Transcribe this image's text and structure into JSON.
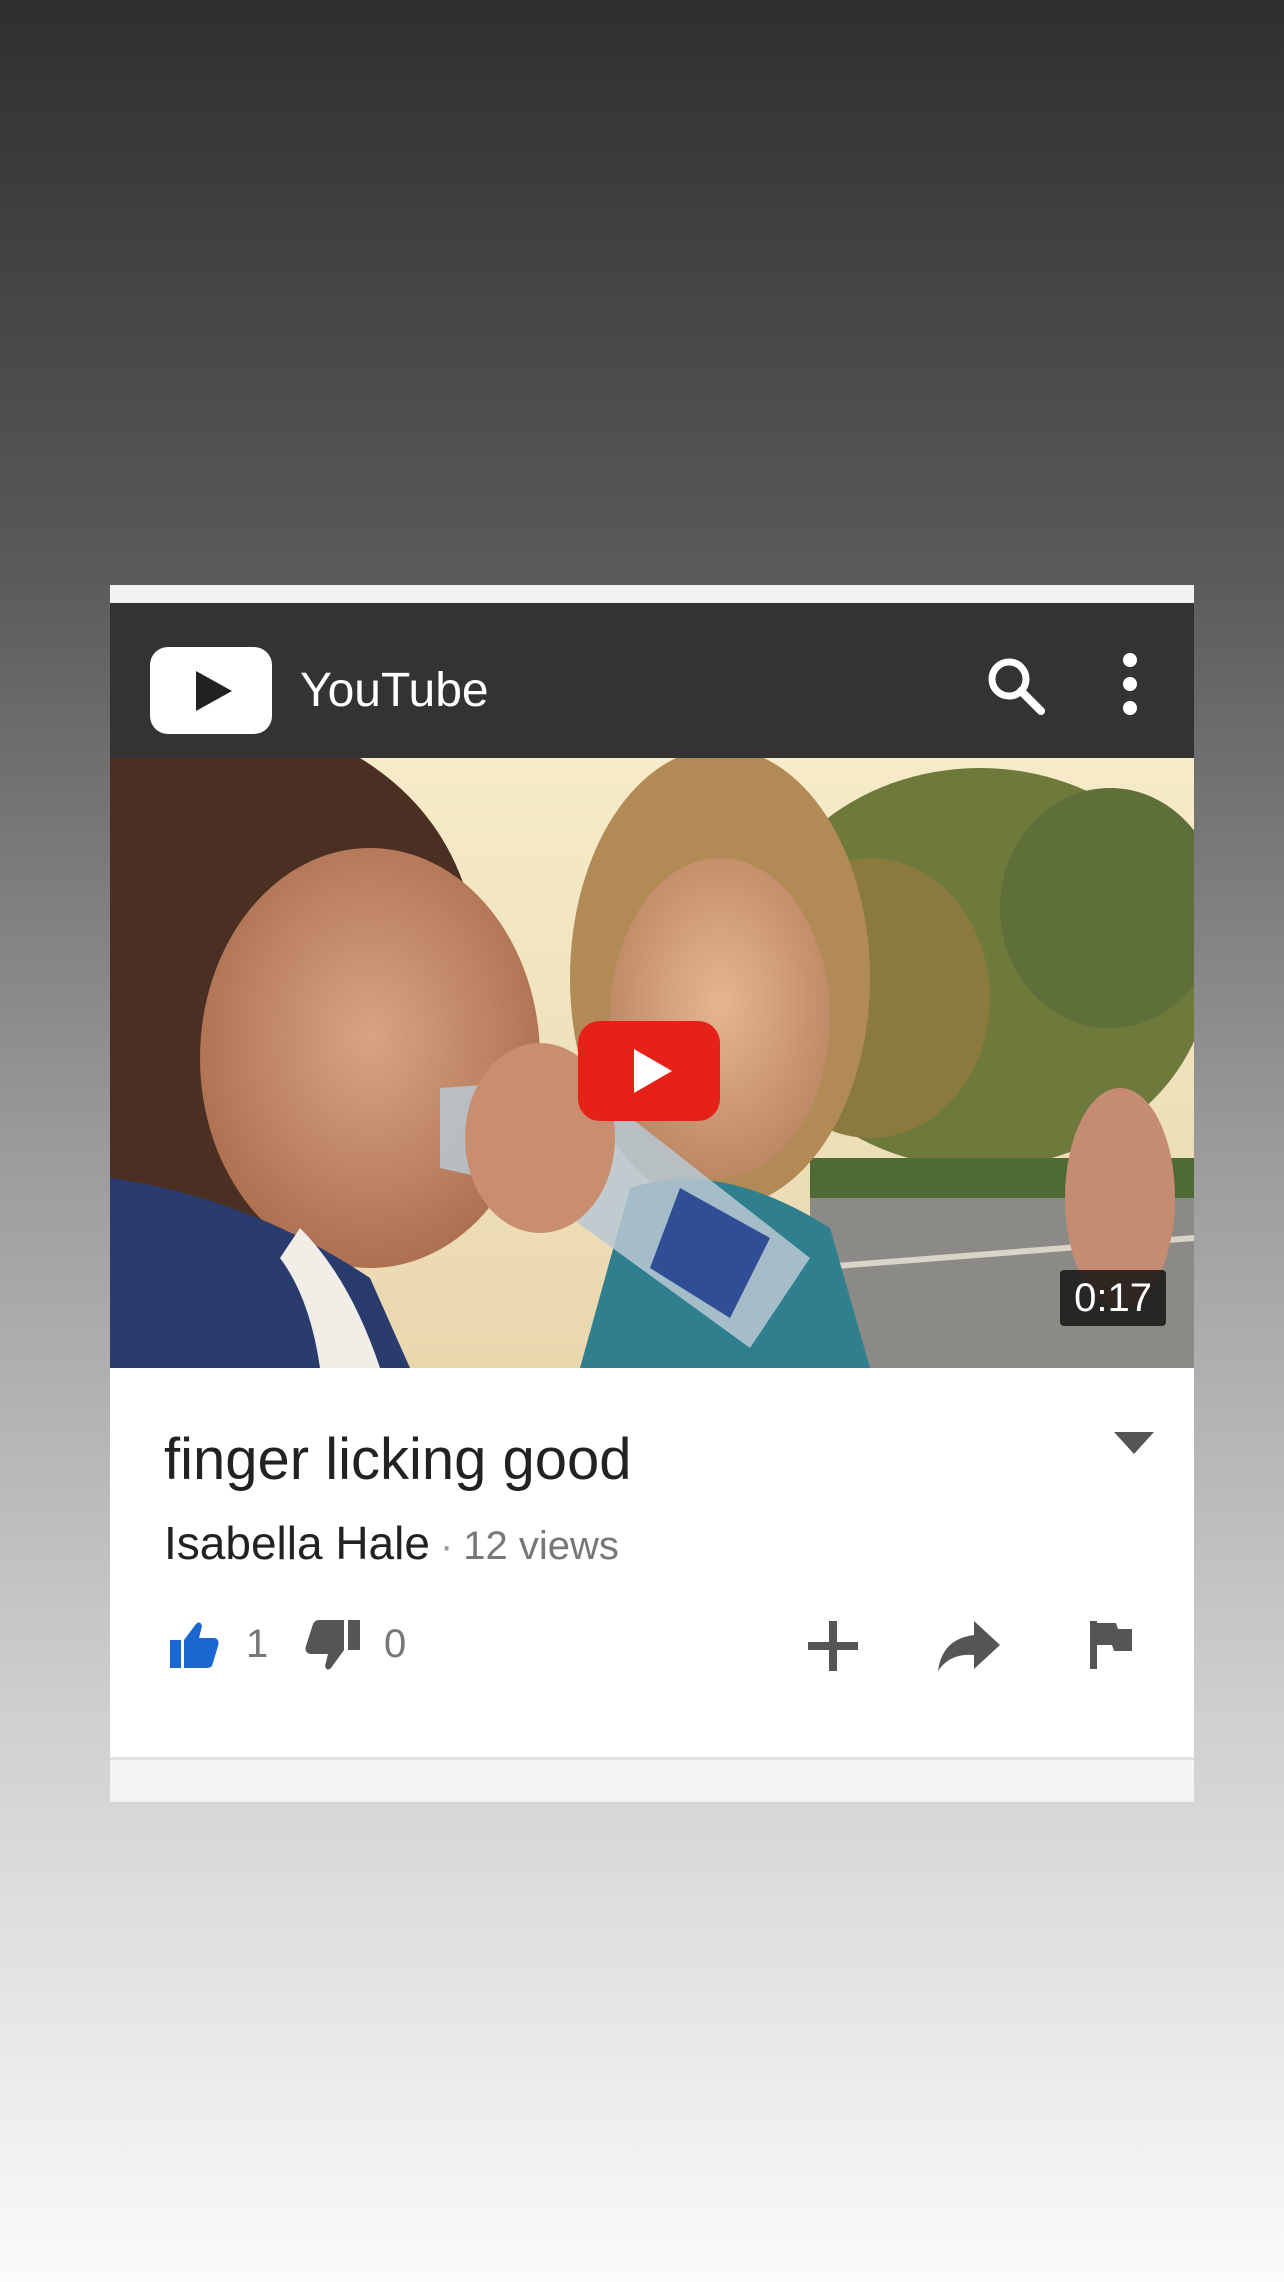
{
  "header": {
    "app_title": "YouTube",
    "background": "#333333"
  },
  "video": {
    "duration": "0:17",
    "title": "finger licking good",
    "channel": "Isabella Hale",
    "separator": "·",
    "views": "12 views",
    "play_button_color": "#e62117"
  },
  "actions": {
    "like_count": "1",
    "like_color": "#1a67d2",
    "dislike_count": "0"
  },
  "icons": {
    "logo": "youtube-play-icon",
    "search": "search-icon",
    "more": "more-vert-icon",
    "expand": "triangle-down-icon",
    "like": "thumbs-up-icon",
    "dislike": "thumbs-down-icon",
    "add": "plus-icon",
    "share": "share-arrow-icon",
    "flag": "flag-icon"
  }
}
